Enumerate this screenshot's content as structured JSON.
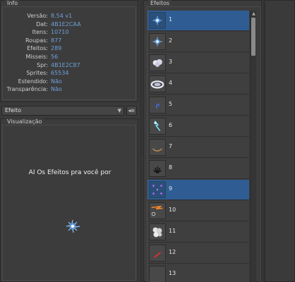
{
  "info": {
    "title": "Info",
    "rows": [
      {
        "key": "Versão:",
        "value": "8.54 v1"
      },
      {
        "key": "Dat:",
        "value": "4B1E2CAA"
      },
      {
        "key": "Itens:",
        "value": "10710"
      },
      {
        "key": "Roupas:",
        "value": "877"
      },
      {
        "key": "Efeitos:",
        "value": "289"
      },
      {
        "key": "Misseis:",
        "value": "56"
      },
      {
        "key": "Spr:",
        "value": "4B1E2C87"
      },
      {
        "key": "Sprites:",
        "value": "65534"
      },
      {
        "key": "Estendido:",
        "value": "Não"
      },
      {
        "key": "Transparência:",
        "value": "Não"
      }
    ]
  },
  "selector": {
    "selected": "Efeito",
    "button_icon": "list-toggle-icon"
  },
  "visualizacao": {
    "title": "Visualização",
    "text": "AI Os Efeitos pra você por"
  },
  "effects": {
    "title": "Efeitos",
    "items": [
      {
        "id": "1",
        "icon": "blue-spark-icon",
        "selected": true
      },
      {
        "id": "2",
        "icon": "blue-spark-icon",
        "selected": false
      },
      {
        "id": "3",
        "icon": "white-cloud-icon",
        "selected": false
      },
      {
        "id": "4",
        "icon": "white-ring-icon",
        "selected": false
      },
      {
        "id": "5",
        "icon": "blue-swirl-icon",
        "selected": false
      },
      {
        "id": "6",
        "icon": "cyan-flash-icon",
        "selected": false
      },
      {
        "id": "7",
        "icon": "brown-arc-icon",
        "selected": false
      },
      {
        "id": "8",
        "icon": "dark-splash-icon",
        "selected": false
      },
      {
        "id": "9",
        "icon": "purple-dots-icon",
        "selected": true
      },
      {
        "id": "10",
        "icon": "orange-bolt-icon",
        "selected": false
      },
      {
        "id": "11",
        "icon": "white-smoke-icon",
        "selected": false
      },
      {
        "id": "12",
        "icon": "red-slash-icon",
        "selected": false
      },
      {
        "id": "13",
        "icon": "blank-icon",
        "selected": false
      }
    ]
  },
  "colors": {
    "selection": "#2f5d93",
    "info_value": "#6fa0d8",
    "background": "#3a3a3a"
  }
}
